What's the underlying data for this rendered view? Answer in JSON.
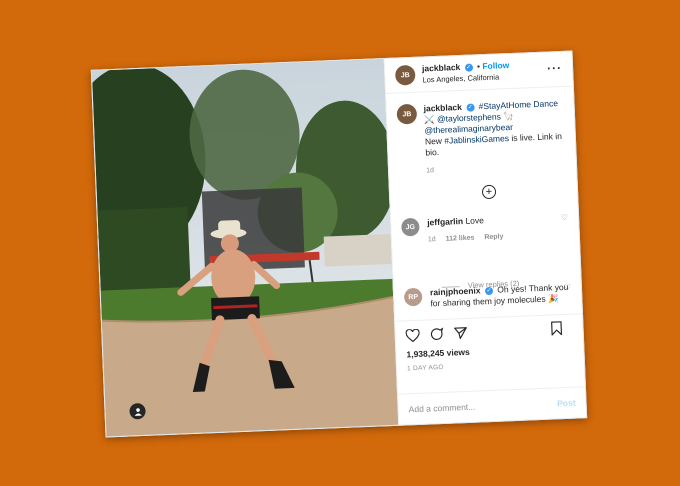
{
  "header": {
    "username": "jackblack",
    "follow_label": "Follow",
    "location": "Los Angeles, California",
    "separator": "•",
    "more_label": "···"
  },
  "caption": {
    "username": "jackblack",
    "line1": "#StayAtHome Dance",
    "line2": "@taylorstephens",
    "line3": "@therealimaginarybear",
    "line4_prefix": "New ",
    "line4_link": "#JablinskiGames",
    "line4_suffix": " is live. Link in",
    "line5": "bio.",
    "time": "1d"
  },
  "comments": [
    {
      "username": "jeffgarlin",
      "text": "Love",
      "time": "1d",
      "likes": "112 likes",
      "reply_label": "Reply",
      "view_replies": "View replies (2)"
    },
    {
      "username": "rainjphoenix",
      "text": "Oh yes! Thank you",
      "text2": "for sharing them joy molecules",
      "emoji": "🎉"
    }
  ],
  "stats": {
    "views": "1,938,245 views",
    "ago": "1 DAY AGO"
  },
  "add_comment": {
    "placeholder": "Add a comment...",
    "post_label": "Post"
  },
  "icons": [
    "heart-icon",
    "comment-icon",
    "share-icon",
    "bookmark-icon",
    "add-icon",
    "user-tag-icon",
    "verified-icon",
    "more-icon"
  ],
  "colors": {
    "background": "#d2690b",
    "link_blue": "#0095f6",
    "verified_blue": "#3897f0"
  }
}
